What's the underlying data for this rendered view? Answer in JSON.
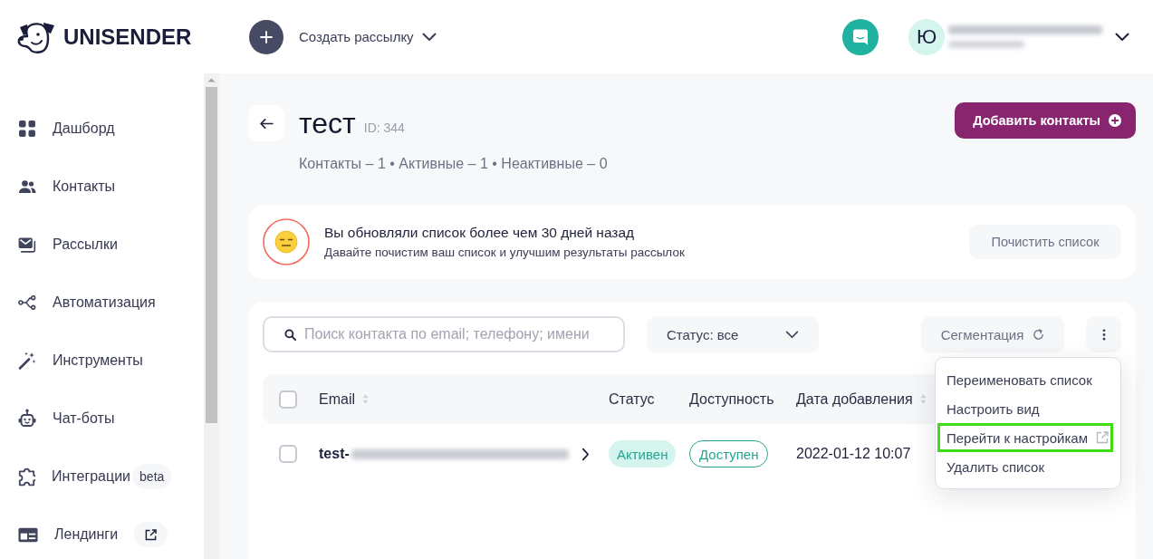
{
  "header": {
    "logo": "UNISENDER",
    "create_menu": {
      "label": "Создать рассылку"
    },
    "avatar": {
      "initial": "Ю"
    }
  },
  "sidebar": {
    "items": [
      {
        "label": "Дашборд",
        "selected": false,
        "external": false
      },
      {
        "label": "Контакты",
        "selected": false,
        "external": false
      },
      {
        "label": "Рассылки",
        "selected": false,
        "external": false
      },
      {
        "label": "Автоматизация",
        "selected": false,
        "external": false
      },
      {
        "label": "Инструменты",
        "selected": false,
        "external": false
      },
      {
        "label": "Чат-боты",
        "selected": false,
        "external": false
      },
      {
        "label": "Интеграции",
        "selected": false,
        "external": false,
        "badge": "beta"
      },
      {
        "label": "Лендинги",
        "selected": false,
        "external": true
      }
    ]
  },
  "page": {
    "title": "тест",
    "id_label": "ID: 344",
    "stats": "Контакты – 1 • Активные – 1 • Неактивные – 0",
    "add_button": "Добавить контакты"
  },
  "notice": {
    "title": "Вы обновляли список более чем 30 дней назад",
    "text": "Давайте почистим ваш список и улучшим результаты рассылок",
    "button": "Почистить список"
  },
  "toolbar": {
    "search": {
      "placeholder": "Поиск контакта по email; телефону; имени"
    },
    "status_filter": "Статус: все",
    "segmentation_button": "Сегментация"
  },
  "table": {
    "select_all": {
      "checked": false
    },
    "columns": [
      {
        "label": "Email",
        "sortable": true
      },
      {
        "label": "Статус",
        "sortable": false
      },
      {
        "label": "Доступность",
        "sortable": false
      },
      {
        "label": "Дата добавления",
        "sortable": true
      }
    ],
    "rows": [
      {
        "checked": false,
        "email": "test-",
        "status": "Активен",
        "availability": "Доступен",
        "added": "2022-01-12 10:07"
      }
    ]
  },
  "menu": {
    "open": true,
    "items": [
      {
        "label": "Переименовать список",
        "highlighted": false,
        "external": false
      },
      {
        "label": "Настроить вид",
        "highlighted": false,
        "external": false
      },
      {
        "label": "Перейти к настройкам",
        "highlighted": true,
        "external": true
      },
      {
        "label": "Удалить список",
        "highlighted": false,
        "external": false
      }
    ]
  }
}
